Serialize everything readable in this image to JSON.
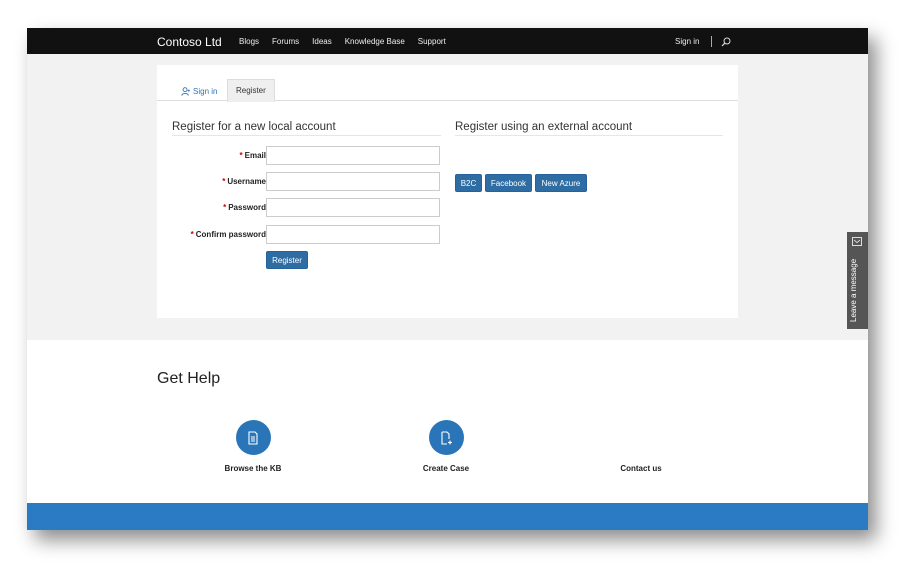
{
  "navbar": {
    "brand": "Contoso Ltd",
    "links": [
      "Blogs",
      "Forums",
      "Ideas",
      "Knowledge Base",
      "Support"
    ],
    "sign_in": "Sign in"
  },
  "tabs": {
    "signin": "Sign in",
    "register": "Register"
  },
  "local": {
    "title": "Register for a new local account",
    "required_mark": "*",
    "fields": [
      {
        "label": "Email",
        "value": ""
      },
      {
        "label": "Username",
        "value": ""
      },
      {
        "label": "Password",
        "value": ""
      },
      {
        "label": "Confirm password",
        "value": ""
      }
    ],
    "submit": "Register"
  },
  "external": {
    "title": "Register using an external account",
    "providers": [
      "B2C",
      "Facebook",
      "New Azure"
    ]
  },
  "help": {
    "title": "Get Help",
    "items": [
      {
        "label": "Browse the KB",
        "icon": "document-icon"
      },
      {
        "label": "Create Case",
        "icon": "new-document-icon"
      },
      {
        "label": "Contact us",
        "icon": ""
      }
    ]
  },
  "feedback": {
    "label": "Leave a message"
  },
  "colors": {
    "accent": "#2a74b8",
    "button": "#2e6da4",
    "navbar": "#111111",
    "footer_bar": "#2b7bc4"
  }
}
